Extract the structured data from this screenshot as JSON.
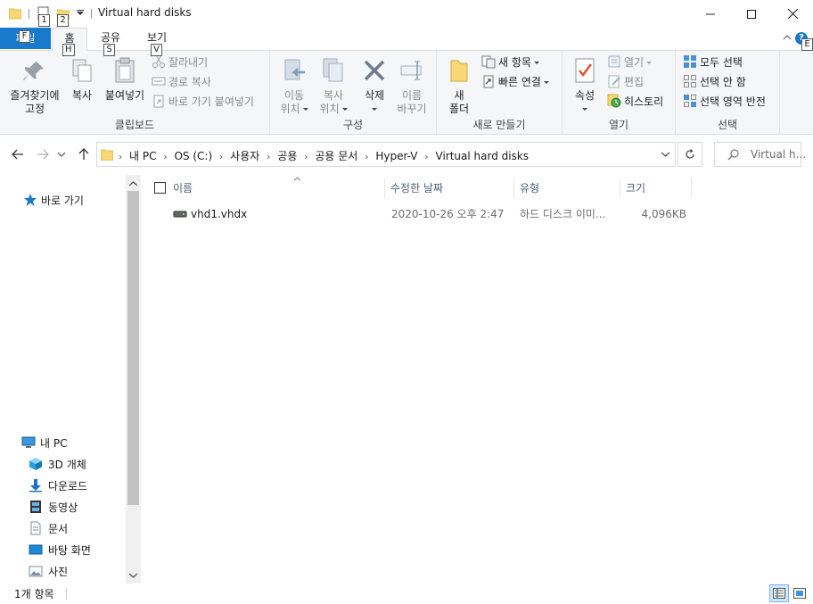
{
  "window": {
    "title": "Virtual hard disks",
    "keytips": [
      "1",
      "2"
    ]
  },
  "ribbon_tabs": {
    "file": {
      "label": "파일",
      "keytip": "F"
    },
    "home": {
      "label": "홈",
      "keytip": "H"
    },
    "share": {
      "label": "공유",
      "keytip": "S"
    },
    "view": {
      "label": "보기",
      "keytip": "V"
    },
    "help_keytip": "E"
  },
  "clipboard": {
    "pin_line1": "즐겨찾기에",
    "pin_line2": "고정",
    "copy": "복사",
    "paste": "붙여넣기",
    "cut": "잘라내기",
    "copy_path": "경로 복사",
    "paste_shortcut": "바로 가기 붙여넣기",
    "group": "클립보드"
  },
  "organize": {
    "move_line1": "이동",
    "move_line2": "위치",
    "copyto_line1": "복사",
    "copyto_line2": "위치",
    "delete": "삭제",
    "rename_line1": "이름",
    "rename_line2": "바꾸기",
    "group": "구성"
  },
  "new": {
    "folder_line1": "새",
    "folder_line2": "폴더",
    "new_item": "새 항목",
    "easy_access": "빠른 연결",
    "group": "새로 만들기"
  },
  "open": {
    "properties": "속성",
    "open": "열기",
    "edit": "편집",
    "history": "히스토리",
    "group": "열기"
  },
  "select": {
    "select_all": "모두 선택",
    "select_none": "선택 안 함",
    "invert": "선택 영역 반전",
    "group": "선택"
  },
  "address": {
    "crumbs": [
      "내 PC",
      "OS (C:)",
      "사용자",
      "공용",
      "공용 문서",
      "Hyper-V",
      "Virtual hard disks"
    ]
  },
  "search": {
    "placeholder": "Virtual h..."
  },
  "nav": {
    "quick_access": "바로 가기",
    "this_pc": "내 PC",
    "items": [
      "3D 개체",
      "다운로드",
      "동영상",
      "문서",
      "바탕 화면",
      "사진"
    ]
  },
  "columns": {
    "name": "이름",
    "modified": "수정한 날짜",
    "type": "유형",
    "size": "크기"
  },
  "files": [
    {
      "name": "vhd1.vhdx",
      "modified": "2020-10-26 오후 2:47",
      "type": "하드 디스크 이미...",
      "size": "4,096KB"
    }
  ],
  "status": {
    "count": "1개 항목"
  },
  "colors": {
    "accent": "#1979ca",
    "folder": "#f8d775",
    "ribbon_bg": "#f5f6f7"
  }
}
